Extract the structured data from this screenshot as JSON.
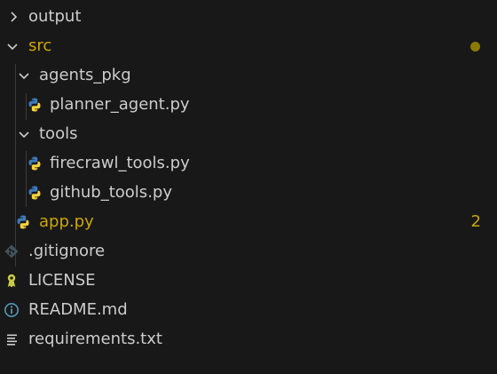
{
  "colors": {
    "background": "#181818",
    "text": "#cccccc",
    "modified": "#cca700",
    "modified_dot": "#8a7a00",
    "python_blue": "#3e7ab8",
    "python_yellow": "#f5d23c",
    "git_icon": "#41535b",
    "license_icon": "#cbcb41",
    "info_icon": "#519aba",
    "guide": "#3b3b3b"
  },
  "tree": {
    "output": {
      "label": "output",
      "icon": "chevron-right-icon"
    },
    "src": {
      "label": "src",
      "icon": "chevron-down-icon",
      "status": "modified-dot"
    },
    "agents_pkg": {
      "label": "agents_pkg",
      "icon": "chevron-down-icon"
    },
    "planner_agent": {
      "label": "planner_agent.py",
      "icon": "python-icon"
    },
    "tools": {
      "label": "tools",
      "icon": "chevron-down-icon"
    },
    "firecrawl_tools": {
      "label": "firecrawl_tools.py",
      "icon": "python-icon"
    },
    "github_tools": {
      "label": "github_tools.py",
      "icon": "python-icon"
    },
    "app": {
      "label": "app.py",
      "icon": "python-icon",
      "problems": "2"
    },
    "gitignore": {
      "label": ".gitignore",
      "icon": "git-icon"
    },
    "license": {
      "label": "LICENSE",
      "icon": "license-icon"
    },
    "readme": {
      "label": "README.md",
      "icon": "info-icon"
    },
    "requirements": {
      "label": "requirements.txt",
      "icon": "lines-icon"
    }
  }
}
